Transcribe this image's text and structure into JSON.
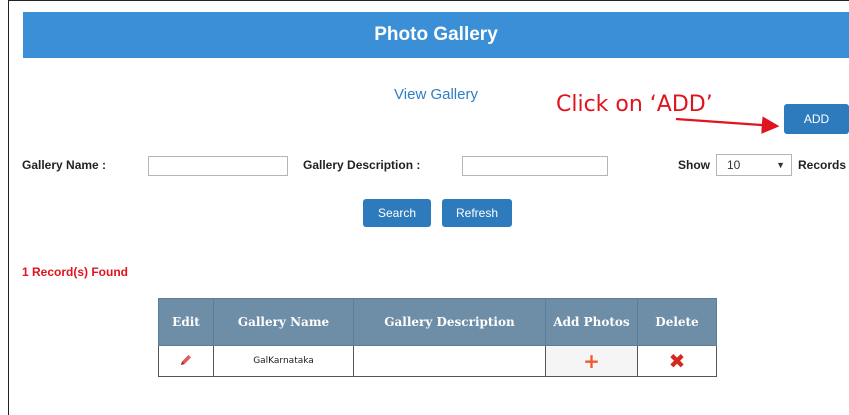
{
  "header": {
    "title": "Photo Gallery"
  },
  "subtitle": "View Gallery",
  "annotation": {
    "text": "Click on ‘ADD’"
  },
  "add_button": "ADD",
  "filters": {
    "gallery_name_label": "Gallery Name :",
    "gallery_name_value": "",
    "gallery_description_label": "Gallery Description :",
    "gallery_description_value": "",
    "show_label": "Show",
    "show_value": "10",
    "records_label": "Records"
  },
  "actions": {
    "search_label": "Search",
    "refresh_label": "Refresh"
  },
  "records_found": "1 Record(s) Found",
  "table": {
    "headers": {
      "edit": "Edit",
      "name": "Gallery Name",
      "description": "Gallery Description",
      "add_photos": "Add Photos",
      "delete": "Delete"
    },
    "rows": [
      {
        "name": "GalKarnataka",
        "description": ""
      }
    ]
  },
  "icons": {
    "edit": "pencil-icon",
    "add": "plus-icon",
    "delete": "cross-icon",
    "dropdown": "chevron-down-icon"
  },
  "colors": {
    "header": "#3a8fd6",
    "button": "#2d7bbd",
    "annotation": "#e0141e",
    "table_header": "#6e8ea8"
  }
}
